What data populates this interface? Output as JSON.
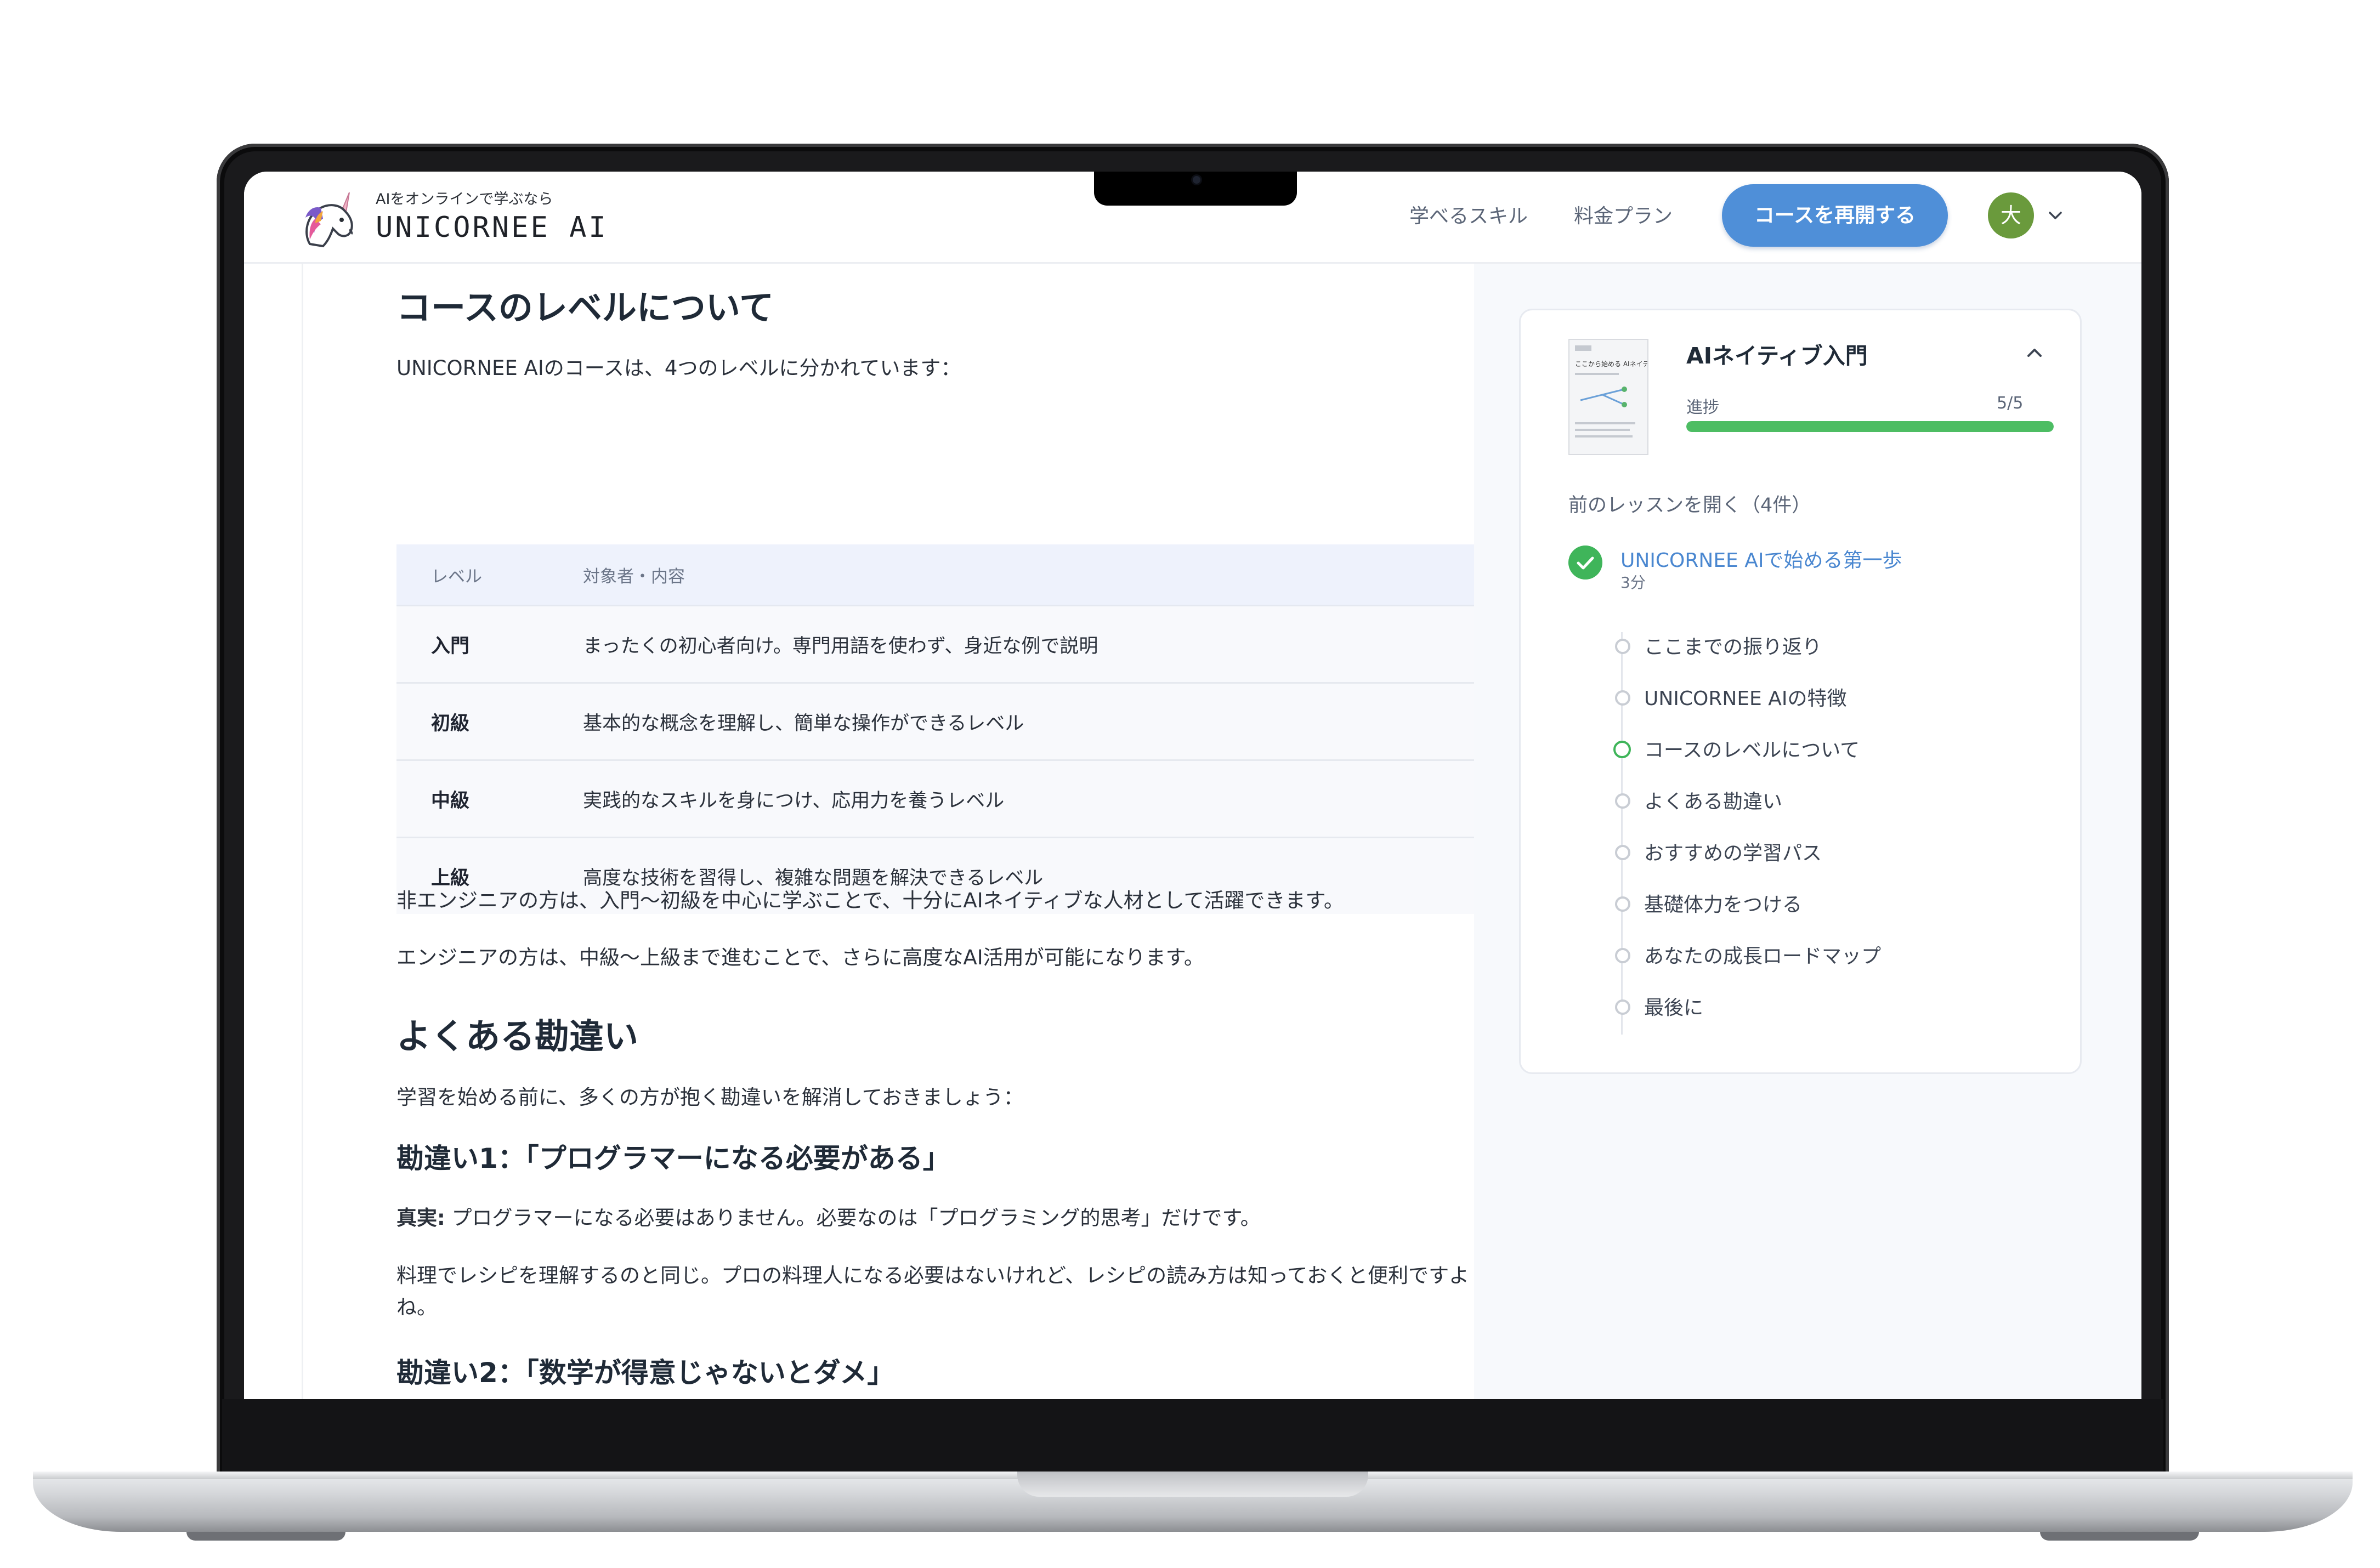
{
  "header": {
    "tagline": "AIをオンラインで学ぶなら",
    "brand": "UNICORNEE AI",
    "nav": [
      "学べるスキル",
      "料金プラン"
    ],
    "cta": "コースを再開する",
    "avatar_initial": "大"
  },
  "main": {
    "levels_heading": "コースのレベルについて",
    "levels_intro": "UNICORNEE AIのコースは、4つのレベルに分かれています：",
    "table": {
      "headers": [
        "レベル",
        "対象者・内容"
      ],
      "rows": [
        [
          "入門",
          "まったくの初心者向け。専門用語を使わず、身近な例で説明"
        ],
        [
          "初級",
          "基本的な概念を理解し、簡単な操作ができるレベル"
        ],
        [
          "中級",
          "実践的なスキルを身につけ、応用力を養うレベル"
        ],
        [
          "上級",
          "高度な技術を習得し、複雑な問題を解決できるレベル"
        ]
      ]
    },
    "para_non_engineer": "非エンジニアの方は、入門〜初級を中心に学ぶことで、十分にAIネイティブな人材として活躍できます。",
    "para_engineer": "エンジニアの方は、中級〜上級まで進むことで、さらに高度なAI活用が可能になります。",
    "misconceptions_heading": "よくある勘違い",
    "misconceptions_intro": "学習を始める前に、多くの方が抱く勘違いを解消しておきましょう：",
    "m1_heading": "勘違い1：「プログラマーになる必要がある」",
    "m1_fact_label": "真実:",
    "m1_fact": " プログラマーになる必要はありません。必要なのは「プログラミング的思考」だけです。",
    "m1_analogy": "料理でレシピを理解するのと同じ。プロの料理人になる必要はないけれど、レシピの読み方は知っておくと便利ですよね。",
    "m2_heading": "勘違い2：「数学が得意じゃないとダメ」"
  },
  "sidebar": {
    "course_title": "AIネイティブ入門",
    "thumbnail_title": "ここから始める AIネイティブ入門",
    "progress_label": "進捗",
    "progress_value": "5/5",
    "progress_fraction": 1.0,
    "prev_lessons_link": "前のレッスンを開く（4件）",
    "completed_lesson": "UNICORNEE AIで始める第一歩",
    "completed_lesson_duration": "3分",
    "lessons": [
      "ここまでの振り返り",
      "UNICORNEE AIの特徴",
      "コースのレベルについて",
      "よくある勘違い",
      "おすすめの学習パス",
      "基礎体力をつける",
      "あなたの成長ロードマップ",
      "最後に"
    ],
    "active_lesson_index": 2
  },
  "colors": {
    "accent_blue": "#4f8fd8",
    "success_green": "#3fb55a",
    "progress_green": "#4dbd63"
  }
}
